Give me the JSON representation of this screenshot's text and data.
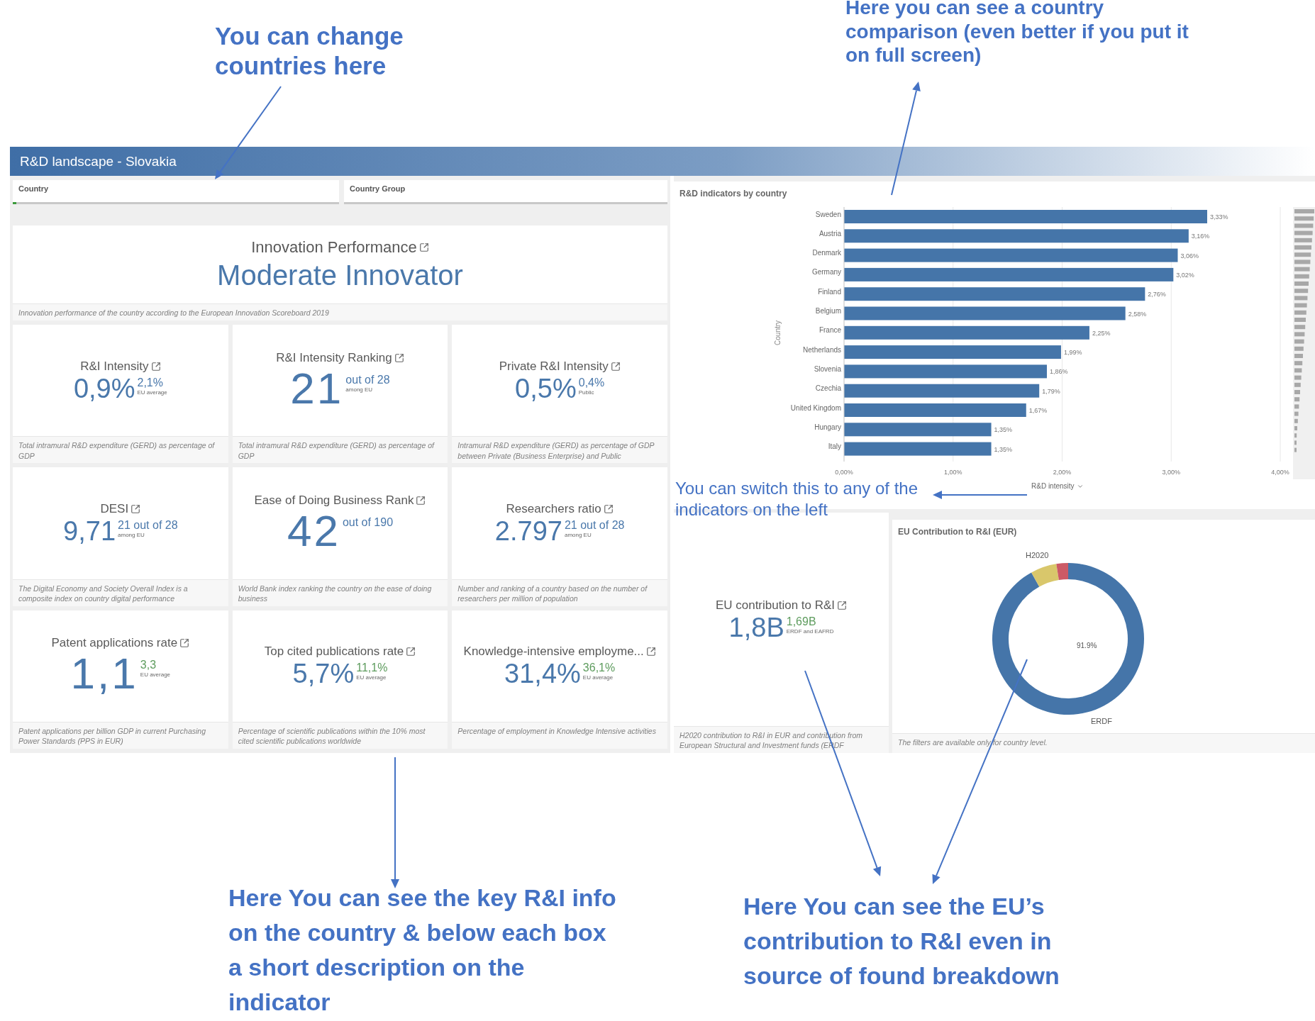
{
  "annotations": {
    "countries_hint": "You can change countries here",
    "comparison_hint": "Here you can see a country comparison (even better if you put it on full screen)",
    "switch_hint": "You can switch this to any of the indicators on the left",
    "key_info_hint": "Here You can see the key R&I info on the country & below each box a short description on the indicator",
    "eu_hint": "Here You can see the EU’s contribution to R&I even in source of found breakdown"
  },
  "dashboard": {
    "title": "R&D landscape - Slovakia",
    "filters": [
      {
        "label": "Country"
      },
      {
        "label": "Country Group"
      }
    ],
    "headline": {
      "title": "Innovation Performance",
      "value": "Moderate Innovator",
      "description": "Innovation performance of the country according to the European Innovation Scoreboard 2019"
    },
    "kpis": [
      {
        "title": "R&I Intensity",
        "value": "0,9%",
        "emphasis": false,
        "side": {
          "value": "2,1%",
          "note": "EU average",
          "color": "#4a78ab"
        },
        "description": "Total intramural R&D expenditure (GERD) as percentage of GDP"
      },
      {
        "title": "R&I Intensity Ranking",
        "value": "21",
        "emphasis": true,
        "side": {
          "value": "out of 28",
          "note": "among EU",
          "color": "#4a78ab"
        },
        "description": "Total intramural R&D expenditure (GERD) as percentage of GDP"
      },
      {
        "title": "Private R&I Intensity",
        "value": "0,5%",
        "emphasis": false,
        "side": {
          "value": "0,4%",
          "note": "Public",
          "color": "#4a78ab"
        },
        "description": "Intramural R&D expenditure (GERD) as percentage of GDP between Private (Business Enterprise) and Public"
      },
      {
        "title": "DESI",
        "value": "9,71",
        "emphasis": false,
        "side": {
          "value": "21 out of 28",
          "note": "among EU",
          "color": "#4a78ab"
        },
        "description": "The Digital Economy and Society Overall Index is a composite index on country digital performance"
      },
      {
        "title": "Ease of Doing Business Rank",
        "value": "42",
        "emphasis": true,
        "side": {
          "value": "out of 190",
          "color": "#4a78ab"
        },
        "description": "World Bank index ranking the country on the ease of doing business"
      },
      {
        "title": "Researchers ratio",
        "value": "2.797",
        "emphasis": false,
        "side": {
          "value": "21 out of 28",
          "note": "among EU",
          "color": "#4a78ab"
        },
        "description": "Number and ranking of a country based on the number of researchers per million of population"
      },
      {
        "title": "Patent applications rate",
        "value": "1,1",
        "emphasis": true,
        "side": {
          "value": "3,3",
          "note": "EU average",
          "color": "#5e9c5e"
        },
        "description": "Patent applications per billion GDP in current Purchasing Power Standards (PPS in EUR)"
      },
      {
        "title": "Top cited publications rate",
        "value": "5,7%",
        "emphasis": false,
        "side": {
          "value": "11,1%",
          "note": "EU average",
          "color": "#5e9c5e"
        },
        "description": "Percentage of scientific publications within the 10% most cited scientific publications worldwide"
      },
      {
        "title": "Knowledge-intensive employme...",
        "value": "31,4%",
        "emphasis": false,
        "side": {
          "value": "36,1%",
          "note": "EU average",
          "color": "#5e9c5e"
        },
        "description": "Percentage of employment in Knowledge Intensive activities"
      }
    ],
    "chart": {
      "title": "R&D indicators by country",
      "measure": "R&D intensity",
      "chart_data": {
        "type": "bar",
        "orientation": "horizontal",
        "ylabel": "Country",
        "categories": [
          "Sweden",
          "Austria",
          "Denmark",
          "Germany",
          "Finland",
          "Belgium",
          "France",
          "Netherlands",
          "Slovenia",
          "Czechia",
          "United Kingdom",
          "Hungary",
          "Italy"
        ],
        "values": [
          3.33,
          3.16,
          3.06,
          3.02,
          2.76,
          2.58,
          2.25,
          1.99,
          1.86,
          1.79,
          1.67,
          1.35,
          1.35
        ],
        "value_labels": [
          "3,33%",
          "3,16%",
          "3,06%",
          "3,02%",
          "2,76%",
          "2,58%",
          "2,25%",
          "1,99%",
          "1,86%",
          "1,79%",
          "1,67%",
          "1,35%",
          "1,35%"
        ],
        "xlim": [
          0,
          4
        ],
        "grid": true,
        "xticks": [
          {
            "value": 0,
            "label": "0,00%"
          },
          {
            "value": 1,
            "label": "1,00%"
          },
          {
            "value": 2,
            "label": "2,00%"
          },
          {
            "value": 3,
            "label": "3,00%"
          },
          {
            "value": 4,
            "label": "4,00%"
          }
        ]
      }
    },
    "eu_contribution": {
      "title": "EU contribution to R&I",
      "value": "1,8B",
      "emphasis": false,
      "side": {
        "value": "1,69B",
        "note": "ERDF and EAFRD",
        "color": "#5e9c5e"
      },
      "description": "H2020 contribution to R&I in EUR and contribution from European Structural and Investment funds (ERDF"
    },
    "funding": {
      "title": "EU Contribution to R&I (EUR)",
      "top_label": "H2020",
      "bottom_label": "ERDF",
      "center_label": "91.9%",
      "note": "The filters are available only for country level."
    }
  }
}
